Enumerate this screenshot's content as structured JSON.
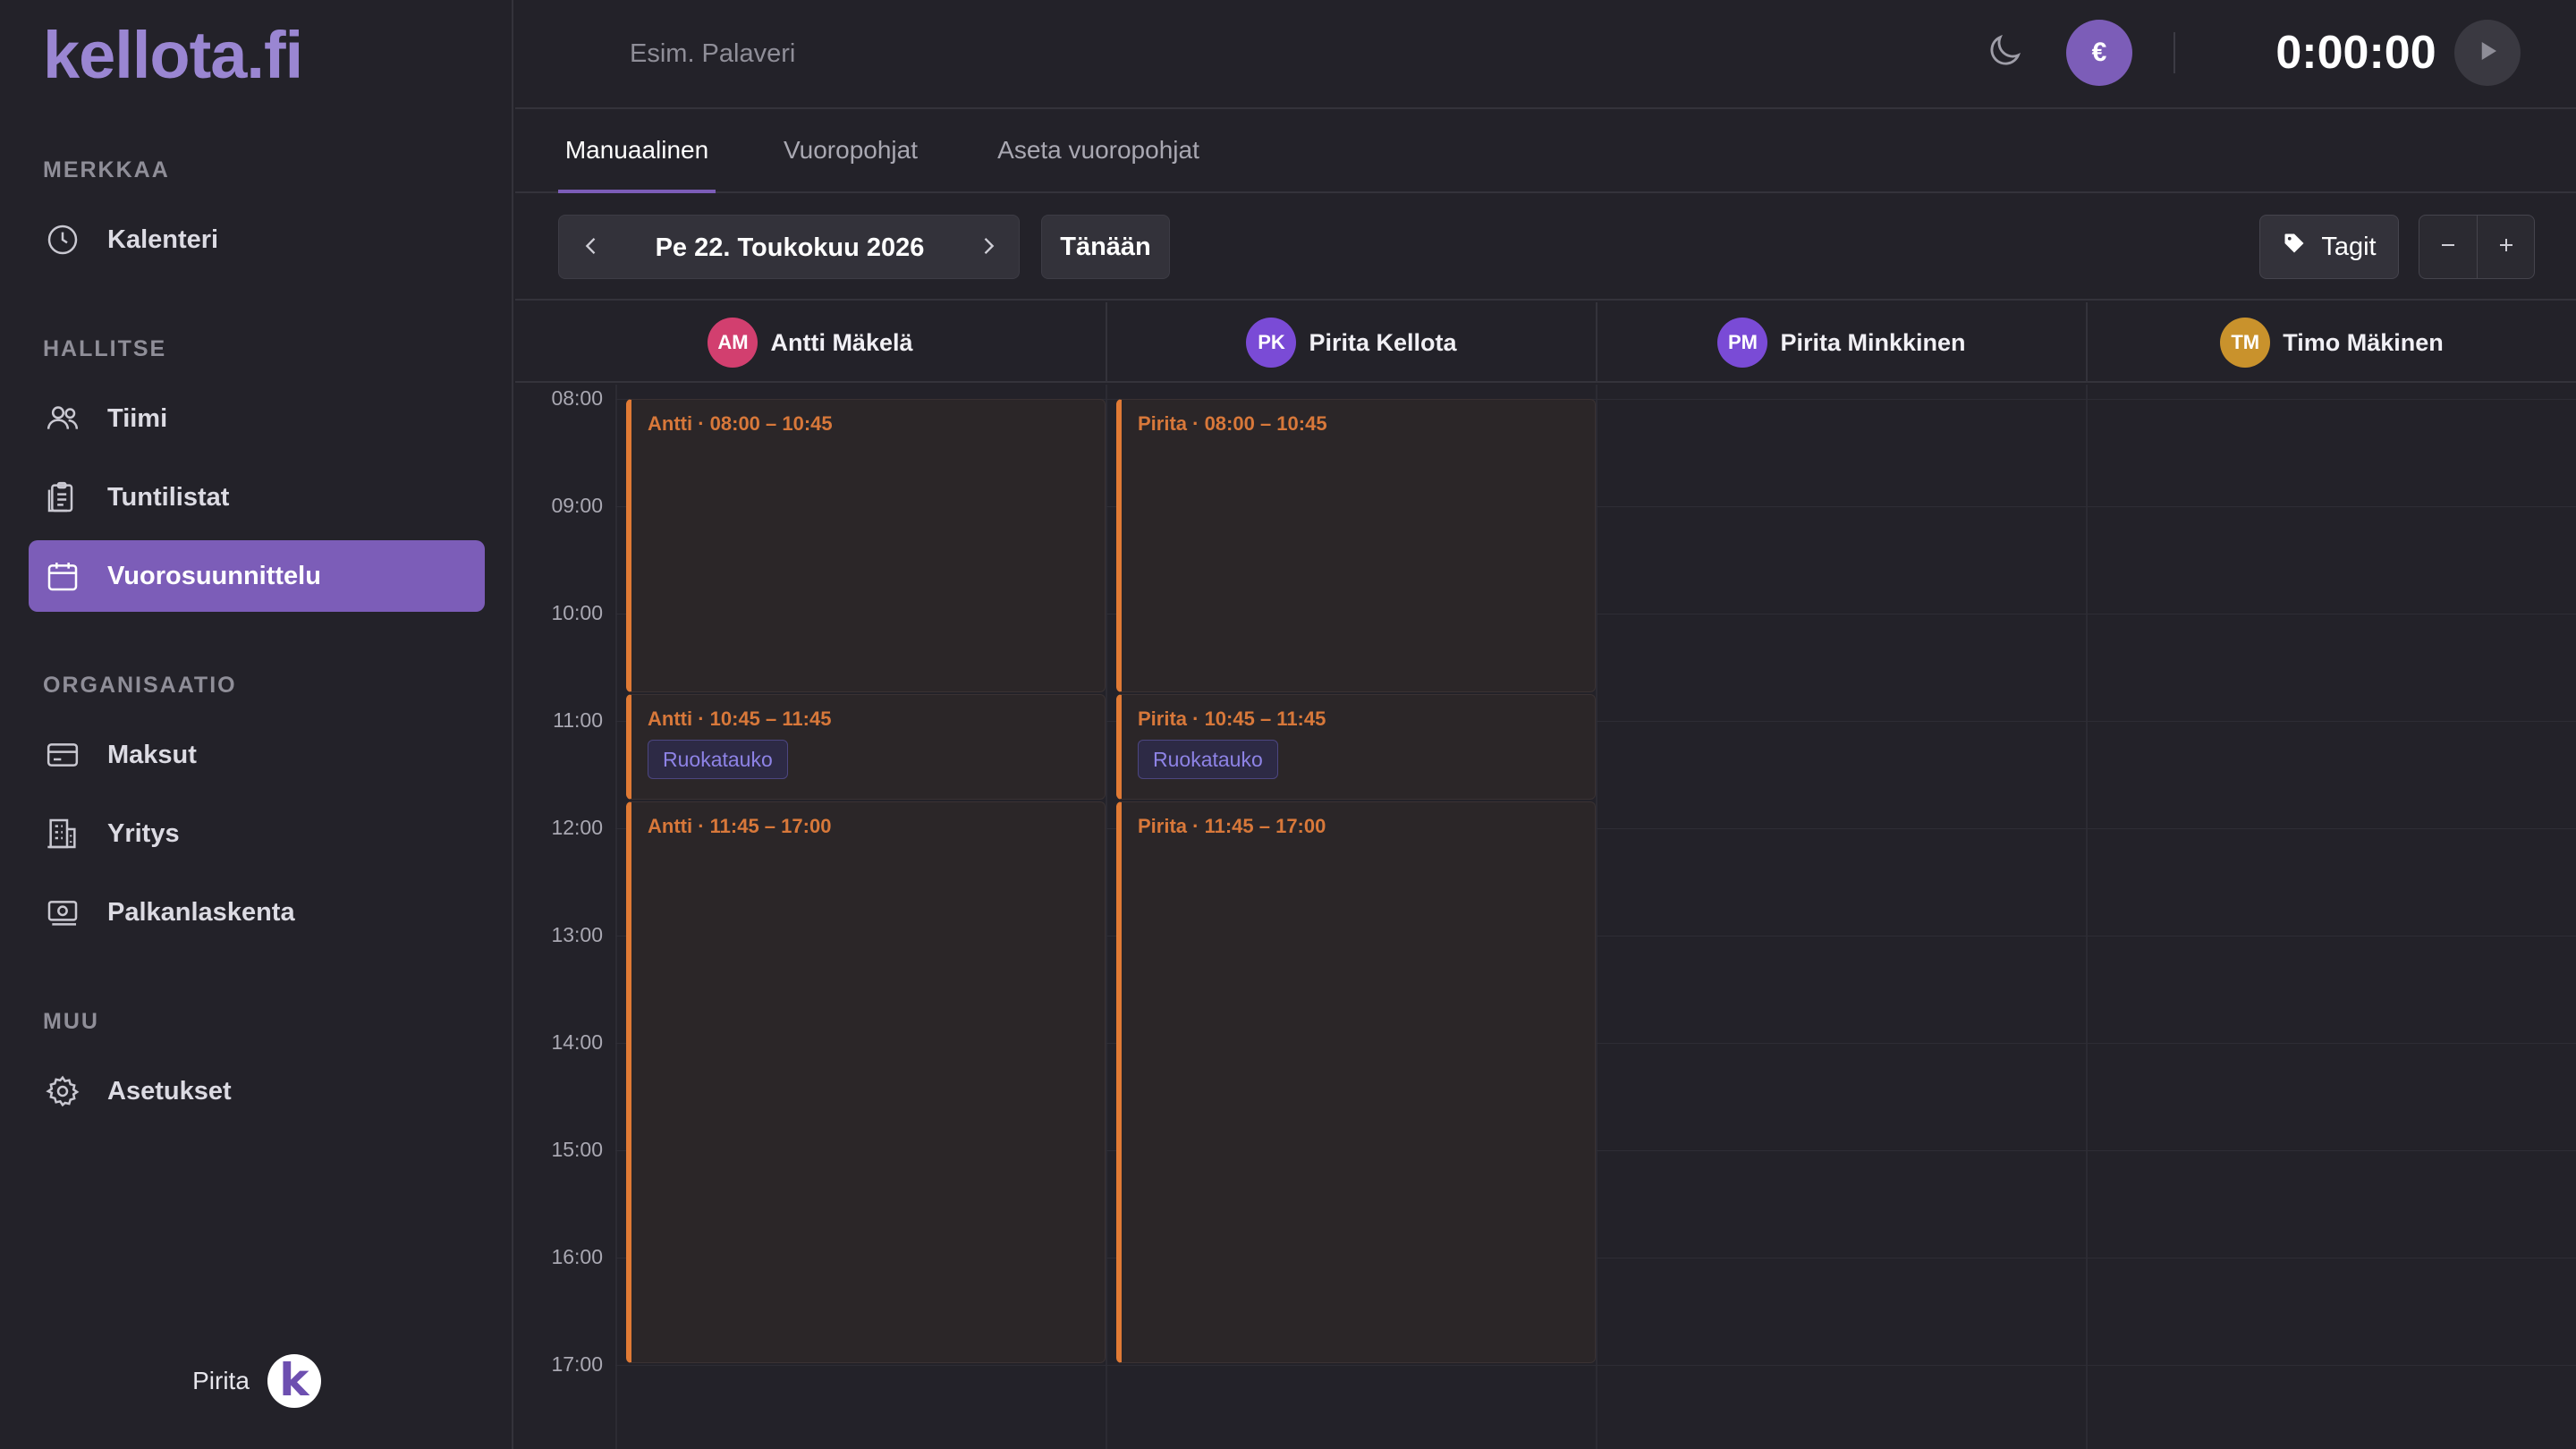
{
  "app": {
    "logo": "kellota.fi"
  },
  "sidebar": {
    "sections": [
      {
        "label": "MERKKAA"
      },
      {
        "label": "HALLITSE"
      },
      {
        "label": "ORGANISAATIO"
      },
      {
        "label": "MUU"
      }
    ],
    "items": [
      {
        "label": "Kalenteri",
        "icon": "clock-icon"
      },
      {
        "label": "Tiimi",
        "icon": "users-icon"
      },
      {
        "label": "Tuntilistat",
        "icon": "clipboard-icon"
      },
      {
        "label": "Vuorosuunnittelu",
        "icon": "calendar-icon",
        "active": true
      },
      {
        "label": "Maksut",
        "icon": "credit-card-icon"
      },
      {
        "label": "Yritys",
        "icon": "building-icon"
      },
      {
        "label": "Palkanlaskenta",
        "icon": "banknote-icon"
      },
      {
        "label": "Asetukset",
        "icon": "gear-icon"
      }
    ],
    "user": {
      "name": "Pirita",
      "avatar_letter": "k"
    }
  },
  "topbar": {
    "description_placeholder": "Esim. Palaveri",
    "euro_label": "€",
    "timer": "0:00:00"
  },
  "tabs": [
    {
      "label": "Manuaalinen",
      "active": true
    },
    {
      "label": "Vuoropohjat"
    },
    {
      "label": "Aseta vuoropohjat"
    }
  ],
  "toolbar": {
    "date": "Pe 22. Toukokuu 2026",
    "today_label": "Tänään",
    "tags_label": "Tagit"
  },
  "employees": [
    {
      "initials": "AM",
      "name": "Antti Mäkelä",
      "color": "#d23f6f"
    },
    {
      "initials": "PK",
      "name": "Pirita Kellota",
      "color": "#7a4bd6"
    },
    {
      "initials": "PM",
      "name": "Pirita Minkkinen",
      "color": "#7a4bd6"
    },
    {
      "initials": "TM",
      "name": "Timo Mäkinen",
      "color": "#c9922c"
    }
  ],
  "times": [
    "08:00",
    "09:00",
    "10:00",
    "11:00",
    "12:00",
    "13:00",
    "14:00",
    "15:00",
    "16:00",
    "17:00"
  ],
  "shifts": [
    {
      "employee": 0,
      "title": "Antti · 08:00 – 10:45",
      "start": 8.0,
      "end": 10.75
    },
    {
      "employee": 0,
      "title": "Antti · 10:45 – 11:45",
      "start": 10.75,
      "end": 11.75,
      "tag": "Ruokatauko"
    },
    {
      "employee": 0,
      "title": "Antti · 11:45 – 17:00",
      "start": 11.75,
      "end": 17.0
    },
    {
      "employee": 1,
      "title": "Pirita · 08:00 – 10:45",
      "start": 8.0,
      "end": 10.75
    },
    {
      "employee": 1,
      "title": "Pirita · 10:45 – 11:45",
      "start": 10.75,
      "end": 11.75,
      "tag": "Ruokatauko"
    },
    {
      "employee": 1,
      "title": "Pirita · 11:45 – 17:00",
      "start": 11.75,
      "end": 17.0
    }
  ],
  "colors": {
    "accent": "#7c5db8",
    "shift_border": "#e07a35",
    "tag_text": "#8e83e6"
  }
}
